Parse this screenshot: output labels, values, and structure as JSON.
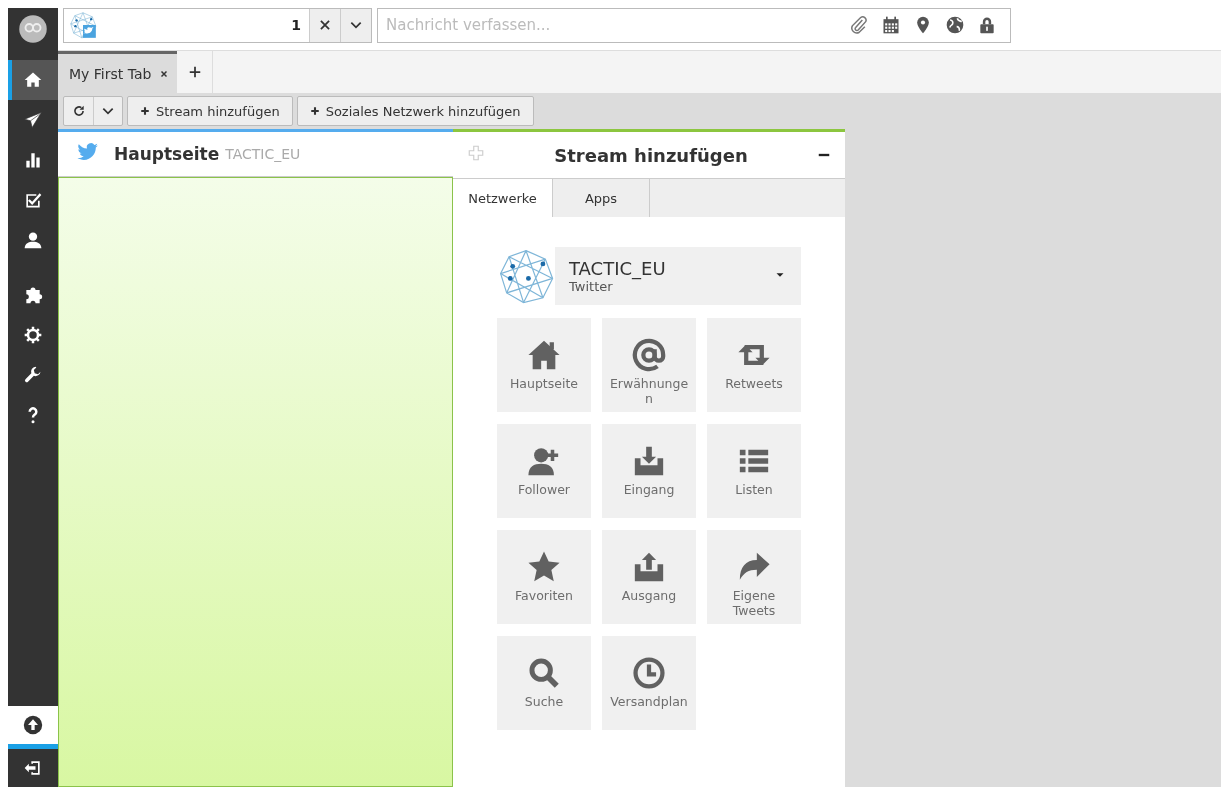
{
  "sidebar": {
    "items": [
      {
        "selected": true
      },
      {
        "selected": false
      },
      {
        "selected": false
      },
      {
        "selected": false
      },
      {
        "selected": false
      },
      {
        "selected": false
      },
      {
        "selected": false
      },
      {
        "selected": false
      },
      {
        "selected": false
      }
    ]
  },
  "compose": {
    "profile_count": "1",
    "placeholder": "Nachricht verfassen..."
  },
  "tabs": [
    {
      "label": "My First Tab",
      "selected": true
    }
  ],
  "toolbar": {
    "buttons": [
      "Stream hinzufügen",
      "Soziales Netzwerk hinzufügen"
    ]
  },
  "stream": {
    "title": "Hauptseite",
    "account": "TACTIC_EU"
  },
  "add_stream": {
    "title": "Stream hinzufügen",
    "tabs": [
      {
        "label": "Netzwerke",
        "selected": true
      },
      {
        "label": "Apps",
        "selected": false
      }
    ],
    "account": {
      "name": "TACTIC_EU",
      "network": "Twitter"
    },
    "stream_types": [
      {
        "label": "Hauptseite",
        "kind": "home"
      },
      {
        "label": "Erwähnungen",
        "kind": "mentions"
      },
      {
        "label": "Retweets",
        "kind": "retweets"
      },
      {
        "label": "Follower",
        "kind": "followers"
      },
      {
        "label": "Eingang",
        "kind": "inbox"
      },
      {
        "label": "Listen",
        "kind": "lists"
      },
      {
        "label": "Favoriten",
        "kind": "favorites"
      },
      {
        "label": "Ausgang",
        "kind": "outbox"
      },
      {
        "label": "Eigene Tweets",
        "kind": "own"
      },
      {
        "label": "Suche",
        "kind": "search"
      },
      {
        "label": "Versandplan",
        "kind": "scheduled"
      }
    ]
  }
}
